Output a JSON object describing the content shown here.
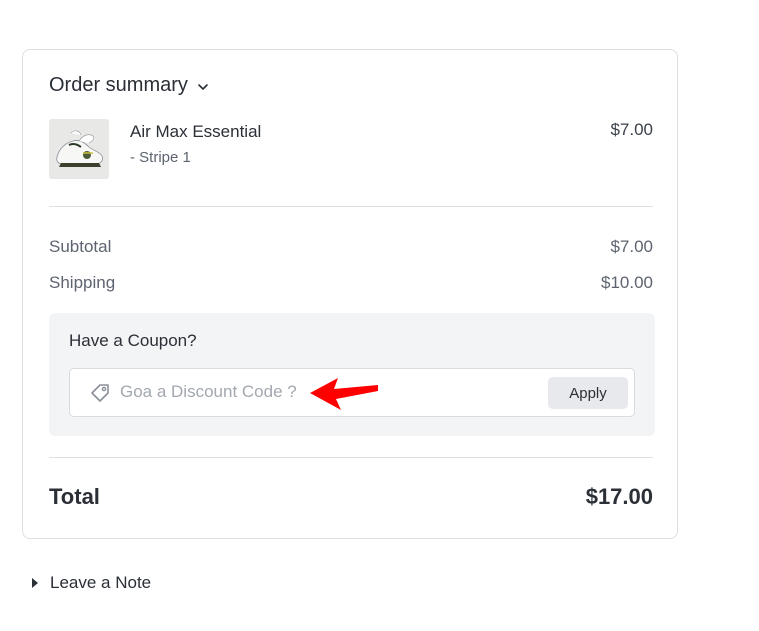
{
  "order_summary": {
    "title": "Order summary",
    "toggle_icon": "chevron-down-icon"
  },
  "product": {
    "name": "Air Max Essential",
    "variant": "- Stripe 1",
    "price": "$7.00",
    "image": "sneaker-thumbnail"
  },
  "lines": {
    "subtotal_label": "Subtotal",
    "subtotal_value": "$7.00",
    "shipping_label": "Shipping",
    "shipping_value": "$10.00"
  },
  "coupon": {
    "title": "Have a Coupon?",
    "placeholder": "Goa a Discount Code ?",
    "value": "",
    "apply_label": "Apply",
    "icon": "tag-icon"
  },
  "total": {
    "label": "Total",
    "value": "$17.00"
  },
  "note": {
    "label": "Leave a Note",
    "icon": "caret-right-icon"
  },
  "colors": {
    "annotation_arrow": "#ff0000",
    "coupon_background": "#f3f4f6",
    "border": "#dcdfe4"
  }
}
